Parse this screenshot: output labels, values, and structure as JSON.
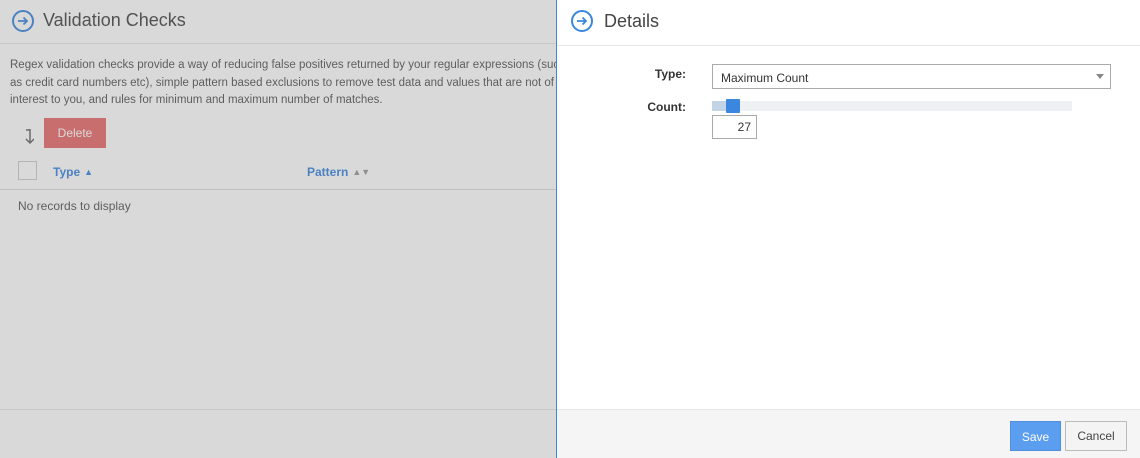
{
  "left": {
    "title": "Validation Checks",
    "description": "Regex validation checks provide a way of reducing false positives returned by your regular expressions (such as credit card numbers etc), simple pattern based exclusions to remove test data and values that are not of interest to you, and rules for minimum and maximum number of matches.",
    "delete_label": "Delete",
    "columns": [
      "Type",
      "Pattern"
    ],
    "empty_message": "No records to display"
  },
  "details": {
    "title": "Details",
    "type_label": "Type:",
    "type_value": "Maximum Count",
    "count_label": "Count:",
    "count_value": "27",
    "slider_fraction": 0.04,
    "save_label": "Save",
    "cancel_label": "Cancel"
  },
  "colors": {
    "accent": "#3b87e0",
    "delete": "#e96b6b",
    "save": "#5b9ef0"
  }
}
